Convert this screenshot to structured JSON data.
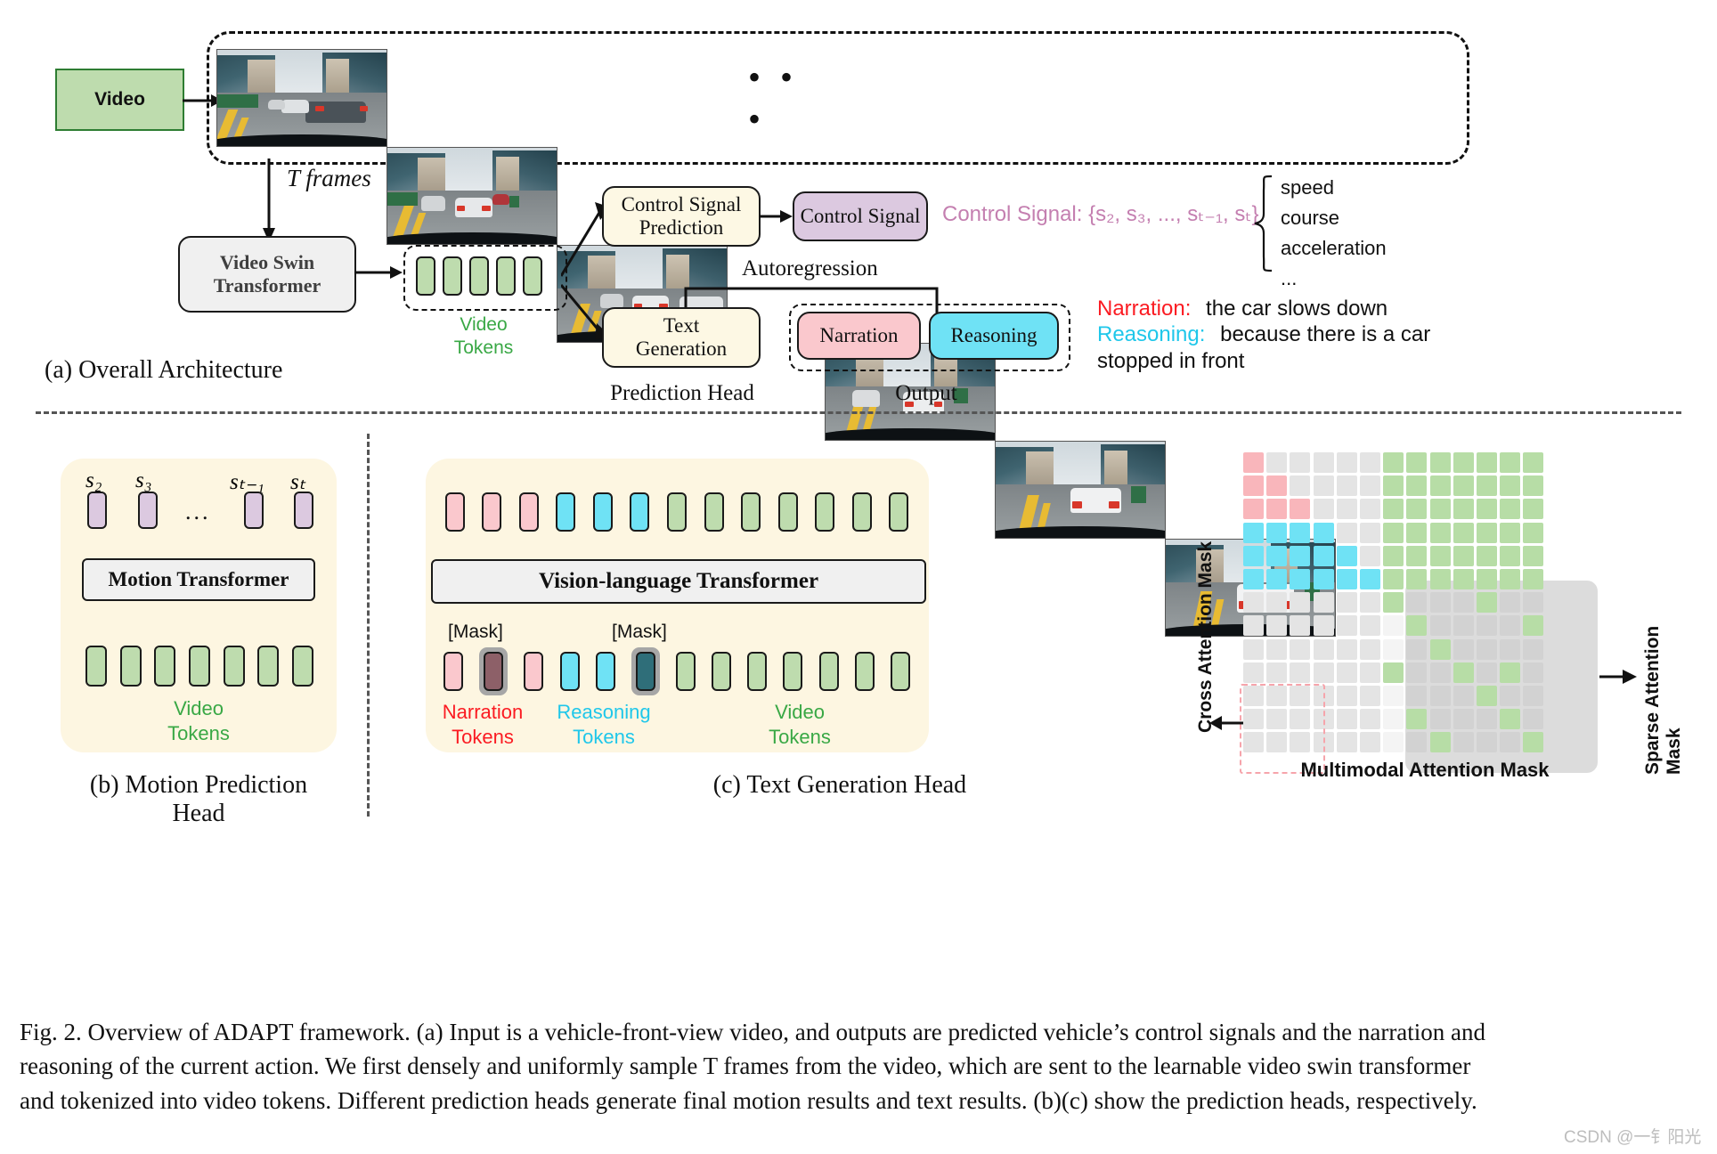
{
  "figure": {
    "id": "Fig. 2.",
    "caption_lines": [
      "Fig. 2.   Overview of ADAPT framework. (a) Input is a vehicle-front-view video, and outputs are predicted vehicle’s control signals and the narration and",
      "reasoning of the current action. We first densely and uniformly sample T frames from the video, which are sent to the learnable video swin transformer",
      "and tokenized into video tokens. Different prediction heads generate final motion results and text results. (b)(c) show the prediction heads, respectively."
    ],
    "watermark": "CSDN @一钅阳光"
  },
  "panel_a": {
    "title": "(a) Overall Architecture",
    "video_box_label": "Video",
    "frames_ellipsis": "• • •",
    "t_frames_label": "T frames",
    "backbone_label_line1": "Video Swin",
    "backbone_label_line2": "Transformer",
    "video_tokens_label_line1": "Video",
    "video_tokens_label_line2": "Tokens",
    "video_tokens_count": 5,
    "control_pred_line1": "Control Signal",
    "control_pred_line2": "Prediction",
    "control_signal_box": "Control Signal",
    "control_signal_formula": "Control Signal: {s₂, s₃, ..., sₜ₋₁, sₜ}",
    "signal_components": [
      "speed",
      "course",
      "acceleration",
      "..."
    ],
    "autoregression_label": "Autoregression",
    "text_gen_line1": "Text",
    "text_gen_line2": "Generation",
    "output_narration": "Narration",
    "output_reasoning": "Reasoning",
    "prediction_head_label": "Prediction Head",
    "output_label": "Output",
    "narration_key": "Narration:",
    "narration_value": "the car slows down",
    "reasoning_key": "Reasoning:",
    "reasoning_value_line1": "because there is a car",
    "reasoning_value_line2": "stopped in front"
  },
  "panel_b": {
    "title": "(b) Motion Prediction Head",
    "signal_labels": [
      "s₂",
      "s₃",
      "sₜ₋₁",
      "sₜ"
    ],
    "ellipsis": "...",
    "transformer_label": "Motion Transformer",
    "video_tokens_label_line1": "Video",
    "video_tokens_label_line2": "Tokens",
    "video_tokens_count": 7,
    "signal_token_count": 4
  },
  "panel_c": {
    "title": "(c) Text Generation Head",
    "transformer_label": "Vision-language Transformer",
    "mask_label": "[Mask]",
    "narration_tokens_label_line1": "Narration",
    "narration_tokens_label_line2": "Tokens",
    "reasoning_tokens_label_line1": "Reasoning",
    "reasoning_tokens_label_line2": "Tokens",
    "video_tokens_label_line1": "Video",
    "video_tokens_label_line2": "Tokens",
    "top_row_tokens": [
      "pink",
      "pink",
      "pink",
      "cyan",
      "cyan",
      "cyan",
      "green",
      "green",
      "green",
      "green",
      "green",
      "green",
      "green"
    ],
    "bottom_row_tokens": [
      "pink",
      "mask-pink",
      "pink",
      "cyan",
      "cyan",
      "mask-cyan",
      "green",
      "green",
      "green",
      "green",
      "green",
      "green",
      "green"
    ]
  },
  "panel_d": {
    "cross_attention_label": "Cross Attention Mask",
    "sparse_attention_label": "Sparse Attention Mask",
    "multimodal_label": "Multimodal Attention Mask",
    "grid_size": 13,
    "legend_colors": {
      "pink": "#f9b6bb",
      "cyan": "#6fe2f5",
      "green": "#b7dda6",
      "gray": "#e4e4e4",
      "highlight_border": "#f6b8bd"
    }
  },
  "colors": {
    "green_fill": "#bedcae",
    "pink_fill": "#fac8cd",
    "cyan_fill": "#6fe2f5",
    "purple_fill": "#dcc9e0",
    "cream_fill": "#fdf6e1",
    "ivory_box": "#fdf8e4",
    "gray_box": "#f0f0f0",
    "narration_text": "#fb1b22",
    "reasoning_text": "#1fc7ea",
    "video_token_text": "#39a845",
    "control_signal_text": "#c47fb0"
  }
}
